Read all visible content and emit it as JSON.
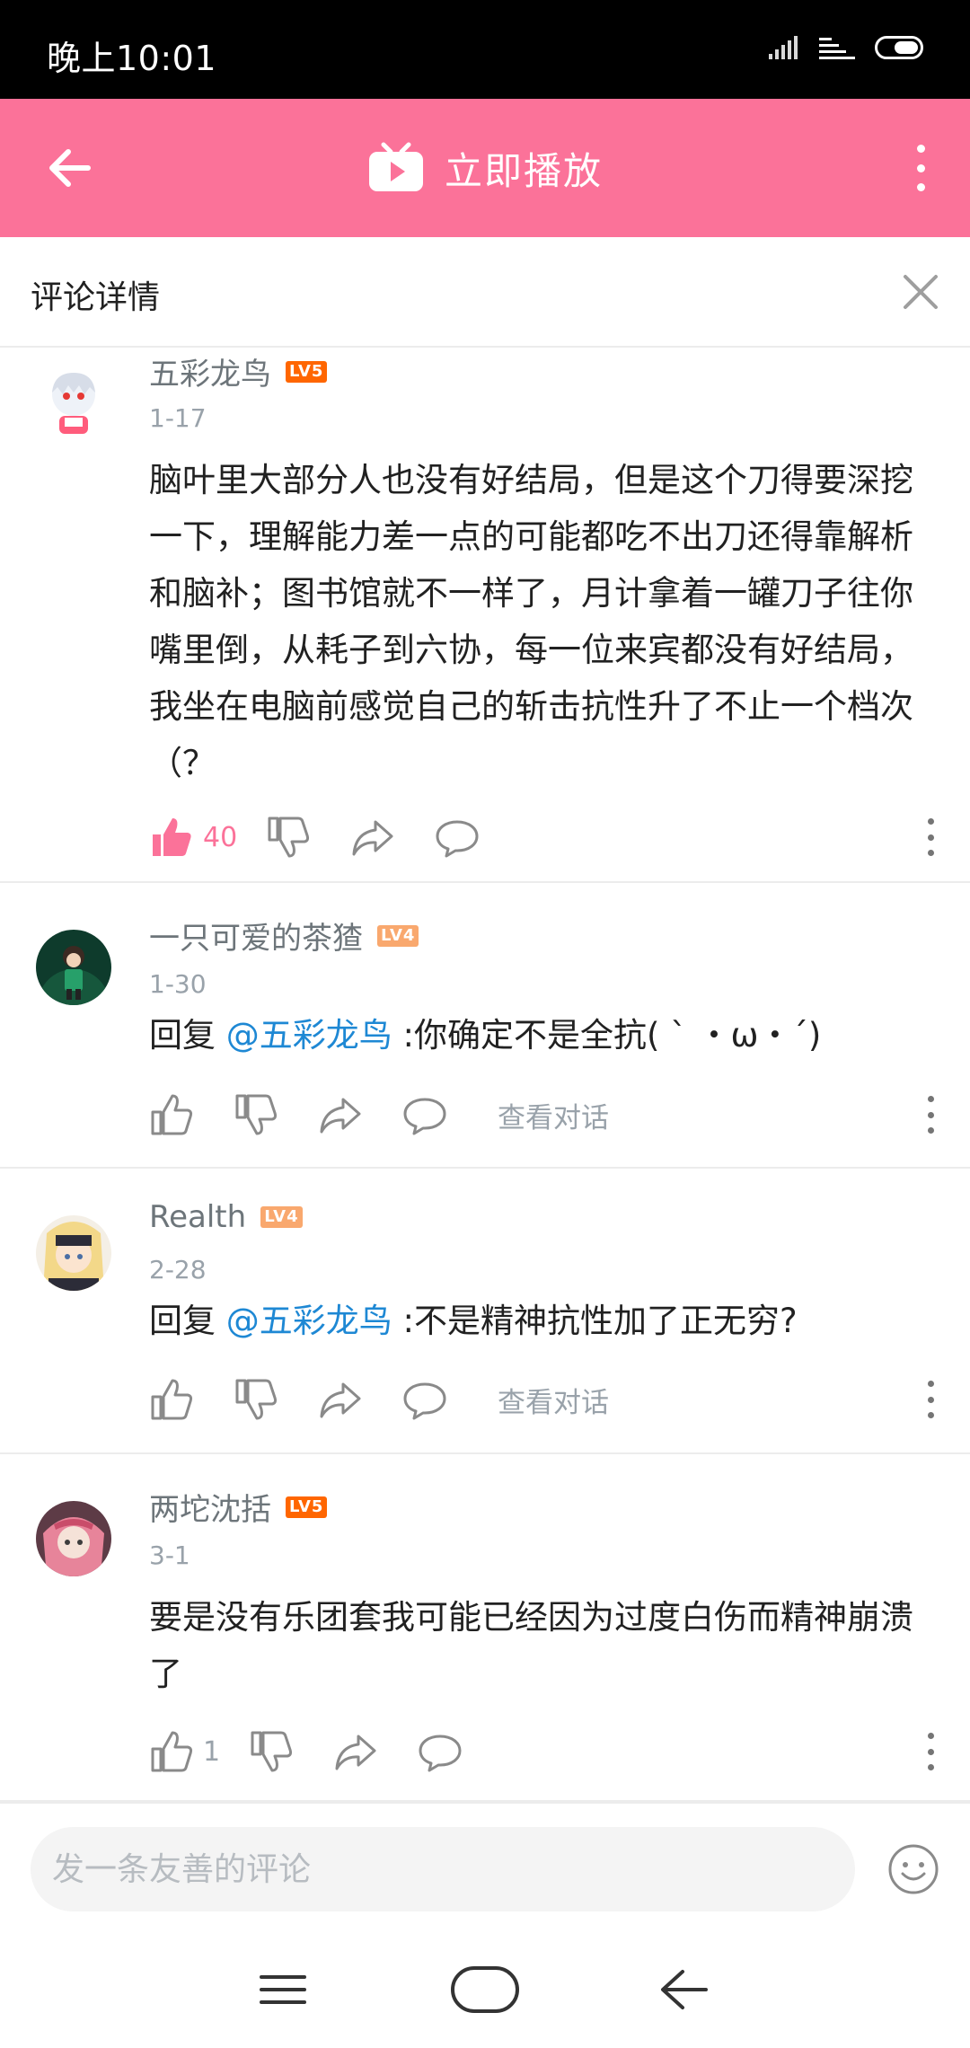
{
  "status_bar": {
    "time": "晚上10:01"
  },
  "header": {
    "title": "立即播放"
  },
  "sub_header": {
    "title": "评论详情"
  },
  "comments": [
    {
      "name": "五彩龙鸟",
      "level": "LV5",
      "date": "1-17",
      "text": "脑叶里大部分人也没有好结局，但是这个刀得要深挖一下，理解能力差一点的可能都吃不出刀还得靠解析和脑补；图书馆就不一样了，月计拿着一罐刀子往你嘴里倒，从耗子到六协，每一位来宾都没有好结局，我坐在电脑前感觉自己的斩击抗性升了不止一个档次（？",
      "like_count": "40"
    },
    {
      "name": "一只可爱的茶猹",
      "level": "LV4",
      "date": "1-30",
      "reply_prefix": "回复 ",
      "mention": "@五彩龙鸟",
      "text": " :你确定不是全抗( ` ・ω・´)",
      "view_conversation": "查看对话"
    },
    {
      "name": "Realth",
      "level": "LV4",
      "date": "2-28",
      "reply_prefix": "回复 ",
      "mention": "@五彩龙鸟",
      "text": " :不是精神抗性加了正无穷?",
      "view_conversation": "查看对话"
    },
    {
      "name": "两坨沈括",
      "level": "LV5",
      "date": "3-1",
      "text": "要是没有乐团套我可能已经因为过度白伤而精神崩溃了",
      "like_count": "1"
    }
  ],
  "input": {
    "placeholder": "发一条友善的评论"
  },
  "colors": {
    "brand_pink": "#fb7299",
    "mention_blue": "#1e88d4",
    "lv5": "#ff6600",
    "lv4": "#f9a86e"
  },
  "icons": [
    "back-arrow-icon",
    "tv-play-icon",
    "more-vertical-icon",
    "close-icon",
    "thumb-up-icon",
    "thumb-down-icon",
    "share-icon",
    "reply-bubble-icon",
    "emoji-icon",
    "menu-icon",
    "home-icon",
    "nav-back-icon"
  ]
}
